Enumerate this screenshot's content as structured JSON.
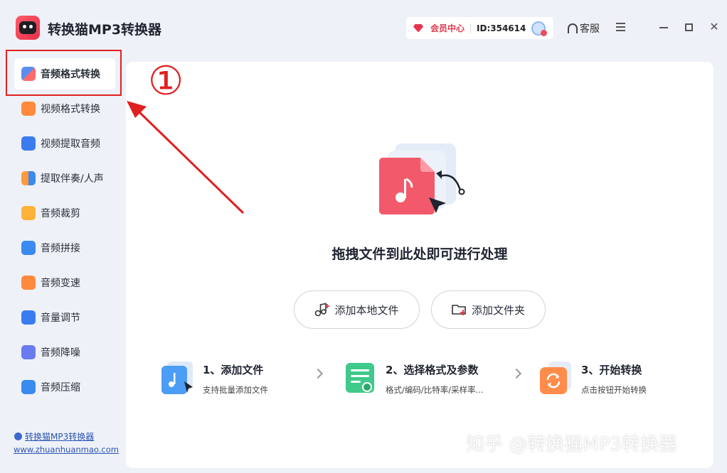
{
  "app": {
    "title": "转换猫MP3转换器"
  },
  "header": {
    "vip_label": "会员中心",
    "user_id": "ID:354614",
    "service_label": "客服"
  },
  "sidebar": {
    "items": [
      {
        "label": "音频格式转换",
        "icon_color": "#5b8def"
      },
      {
        "label": "视频格式转换",
        "icon_color": "#ff8a3d"
      },
      {
        "label": "视频提取音频",
        "icon_color": "#3a7bf0"
      },
      {
        "label": "提取伴奏/人声",
        "icon_color": "#ff9a3c"
      },
      {
        "label": "音频裁剪",
        "icon_color": "#ffb23a"
      },
      {
        "label": "音频拼接",
        "icon_color": "#3a8af0"
      },
      {
        "label": "音频变速",
        "icon_color": "#ff8a3d"
      },
      {
        "label": "音量调节",
        "icon_color": "#3a7bf0"
      },
      {
        "label": "音频降噪",
        "icon_color": "#6a7bf0"
      },
      {
        "label": "音频压缩",
        "icon_color": "#3a8af0"
      }
    ],
    "footer_link": "转换猫MP3转换器",
    "footer_url": "www.zhuanhuanmao.com"
  },
  "main": {
    "drop_text": "拖拽文件到此处即可进行处理",
    "add_file_label": "添加本地文件",
    "add_folder_label": "添加文件夹",
    "steps": [
      {
        "title": "1、添加文件",
        "sub": "支持批量添加文件"
      },
      {
        "title": "2、选择格式及参数",
        "sub": "格式/编码/比特率/采样率..."
      },
      {
        "title": "3、开始转换",
        "sub": "点击按钮开始转换"
      }
    ]
  },
  "annotation": {
    "marker": "①"
  },
  "watermark": "知乎 @转换猫MP3转换器",
  "colors": {
    "accent_red": "#e02020",
    "vip_red": "#e03a4d",
    "link_blue": "#2a55b4"
  }
}
